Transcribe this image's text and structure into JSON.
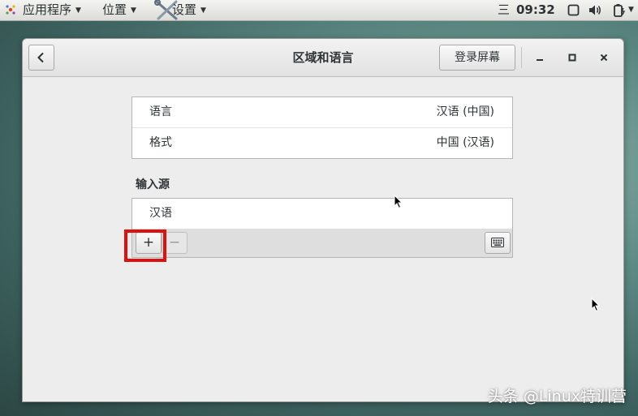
{
  "topbar": {
    "applications_label": "应用程序",
    "places_label": "位置",
    "settings_label": "设置",
    "lang_indicator": "三",
    "clock": "09:32"
  },
  "window": {
    "title": "区域和语言",
    "login_screen_button": "登录屏幕"
  },
  "settings_list": [
    {
      "label": "语言",
      "value": "汉语 (中国)"
    },
    {
      "label": "格式",
      "value": "中国 (汉语)"
    }
  ],
  "input_sources": {
    "title": "输入源",
    "items": [
      "汉语"
    ],
    "add_label": "+",
    "remove_label": "−"
  },
  "watermark": "头条 @Linux特训营",
  "icons": [
    "apps-icon",
    "settings-icon",
    "window-icon",
    "volume-icon",
    "battery-icon",
    "back-icon",
    "minimize-icon",
    "maximize-icon",
    "close-icon",
    "keyboard-icon",
    "pointer-icon"
  ],
  "colors": {
    "highlight": "#e01010",
    "background": "#ededed"
  }
}
